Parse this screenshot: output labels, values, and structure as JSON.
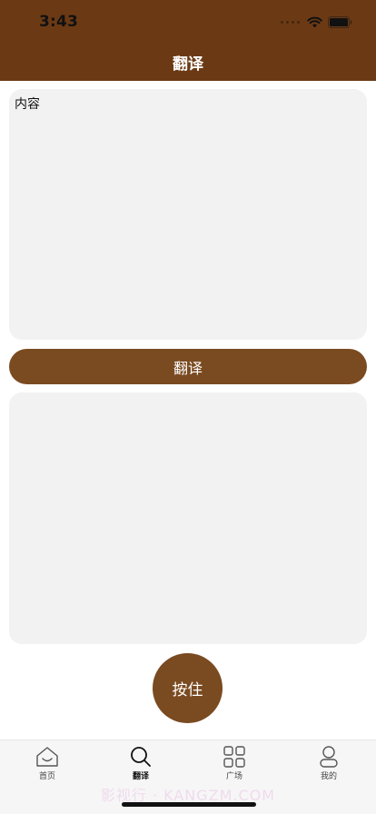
{
  "status_bar": {
    "time": "3:43"
  },
  "nav": {
    "title": "翻译"
  },
  "input": {
    "text": "内容"
  },
  "buttons": {
    "translate": "翻译",
    "hold": "按住"
  },
  "tabs": [
    {
      "label": "首页",
      "icon": "home-icon"
    },
    {
      "label": "翻译",
      "icon": "search-icon",
      "active": true
    },
    {
      "label": "广场",
      "icon": "grid-icon"
    },
    {
      "label": "我的",
      "icon": "profile-icon"
    }
  ],
  "watermark": "影视行 · KANGZM.COM",
  "colors": {
    "header": "#6b3a14",
    "accent": "#7a4a20",
    "panel": "#f2f2f2"
  }
}
